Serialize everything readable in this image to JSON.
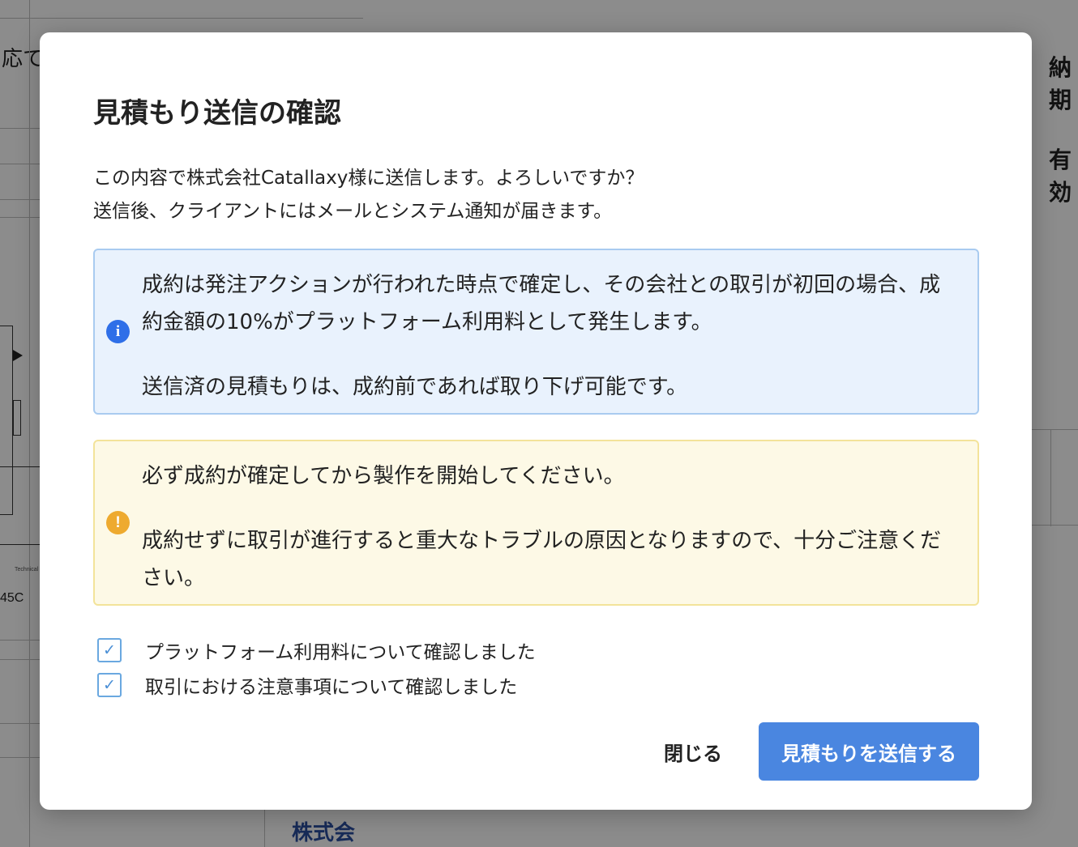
{
  "background": {
    "left_fragments": {
      "top_text": "応て",
      "material": "45C",
      "tiny_note": "Technical refer"
    },
    "right_labels": [
      "納期",
      "有効"
    ],
    "company_partial": "株式会"
  },
  "modal": {
    "title": "見積もり送信の確認",
    "description": [
      "この内容で株式会社Catallaxy様に送信します。よろしいですか？",
      "送信後、クライアントにはメールとシステム通知が届きます。"
    ],
    "info_alert": {
      "icon": "info-icon",
      "color": "#2f6fe8",
      "paragraph1": "成約は発注アクションが行われた時点で確定し、その会社との取引が初回の場合、成約金額の10%がプラットフォーム利用料として発生します。",
      "paragraph2": "送信済の見積もりは、成約前であれば取り下げ可能です。"
    },
    "warning_alert": {
      "icon": "warning-icon",
      "color": "#eeaa2f",
      "paragraph1": "必ず成約が確定してから製作を開始してください。",
      "paragraph2": "成約せずに取引が進行すると重大なトラブルの原因となりますので、十分ご注意ください。"
    },
    "checkboxes": [
      {
        "label": "プラットフォーム利用料について確認しました",
        "checked": true
      },
      {
        "label": "取引における注意事項について確認しました",
        "checked": true
      }
    ],
    "buttons": {
      "close": "閉じる",
      "send": "見積もりを送信する",
      "send_color": "#4a86e0"
    }
  }
}
